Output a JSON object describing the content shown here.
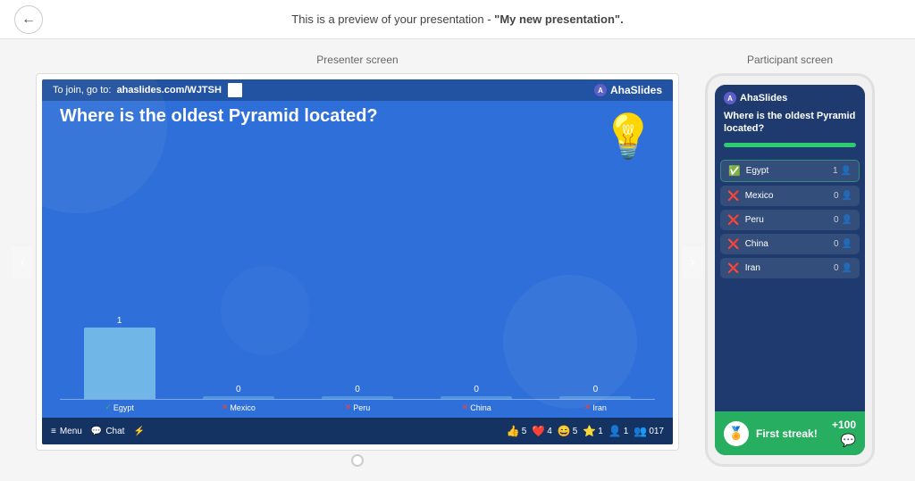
{
  "header": {
    "back_label": "←",
    "preview_text": "This is a preview of your presentation - ",
    "presentation_name": "\"My new presentation\"."
  },
  "presenter": {
    "label": "Presenter screen",
    "join_text": "To join, go to:",
    "join_url": "ahaslides.com/WJTSH",
    "logo": "AhaSlides",
    "question": "Where is the oldest Pyramid located?",
    "bars": [
      {
        "value": "1",
        "height": 80,
        "label": "Egypt",
        "correct": true
      },
      {
        "value": "0",
        "height": 0,
        "label": "Mexico",
        "correct": false
      },
      {
        "value": "0",
        "height": 0,
        "label": "Peru",
        "correct": false
      },
      {
        "value": "0",
        "height": 0,
        "label": "China",
        "correct": false
      },
      {
        "value": "0",
        "height": 0,
        "label": "Iran",
        "correct": false
      }
    ],
    "toolbar": {
      "menu_label": "Menu",
      "chat_label": "Chat",
      "reactions": [
        {
          "emoji": "👍",
          "count": "5"
        },
        {
          "emoji": "❤️",
          "count": "4"
        },
        {
          "emoji": "😄",
          "count": "5"
        },
        {
          "emoji": "⭐",
          "count": "1"
        },
        {
          "emoji": "👤",
          "count": "1"
        },
        {
          "emoji": "👥",
          "count": "017"
        }
      ]
    }
  },
  "participant": {
    "label": "Participant screen",
    "logo": "AhaSlides",
    "question": "Where is the oldest Pyramid located?",
    "answers": [
      {
        "text": "Egypt",
        "correct": true,
        "count": "1"
      },
      {
        "text": "Mexico",
        "correct": false,
        "count": "0"
      },
      {
        "text": "Peru",
        "correct": false,
        "count": "0"
      },
      {
        "text": "China",
        "correct": false,
        "count": "0"
      },
      {
        "text": "Iran",
        "correct": false,
        "count": "0"
      }
    ],
    "streak": {
      "label": "First streak!",
      "points": "+100",
      "emoji": "🏅"
    }
  },
  "colors": {
    "slide_bg": "#2E6FD9",
    "correct_green": "#27ae60",
    "wrong_red": "#e74c3c"
  }
}
